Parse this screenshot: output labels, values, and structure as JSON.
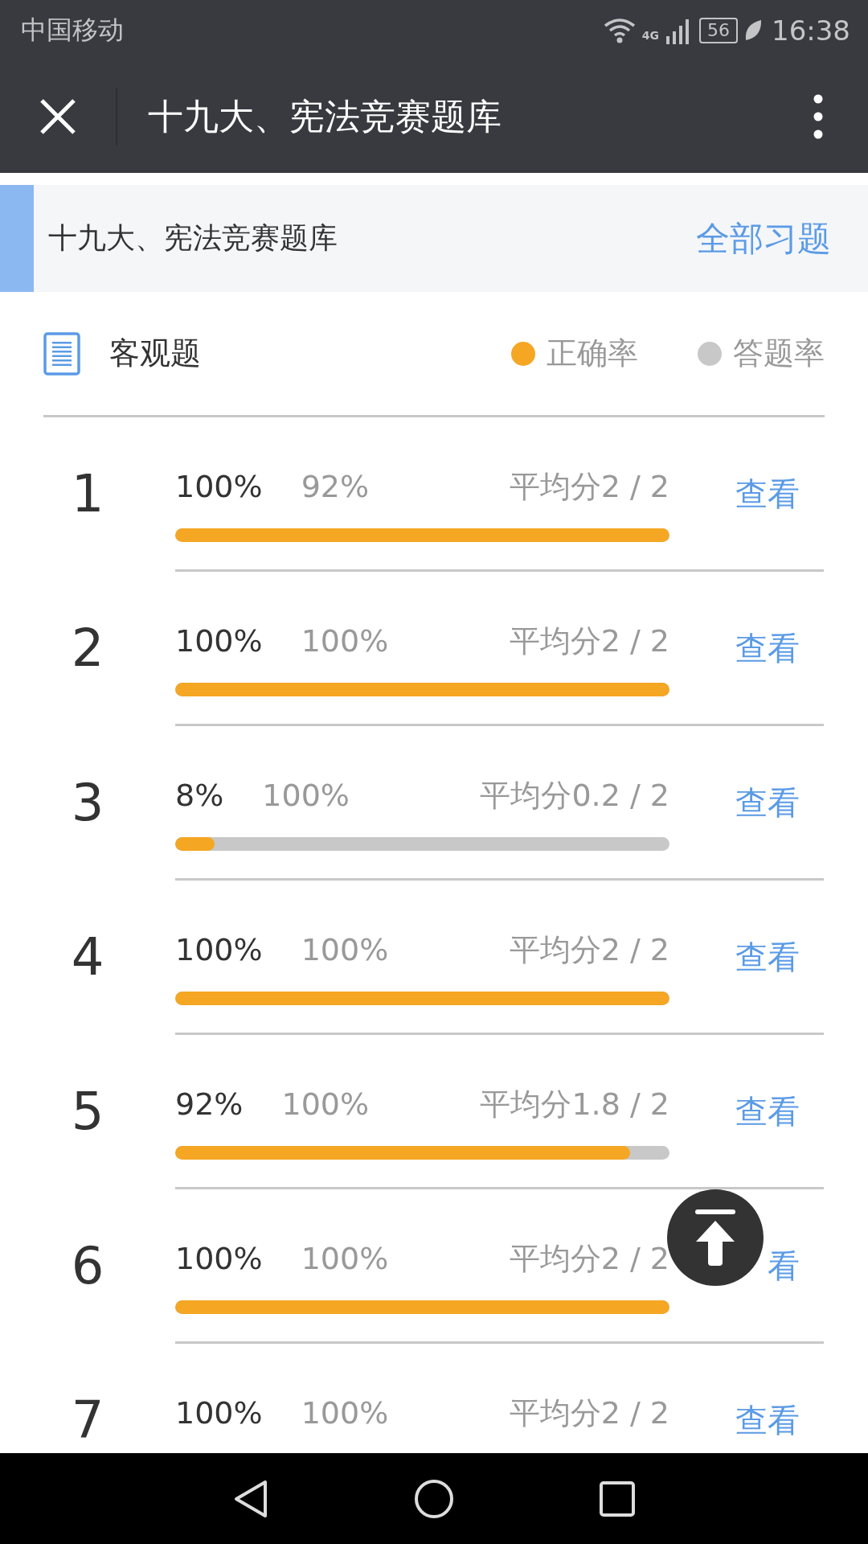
{
  "status_bar": {
    "carrier": "中国移动",
    "network": "4G",
    "battery": "56",
    "time": "16:38"
  },
  "toolbar": {
    "title": "十九大、宪法竞赛题库"
  },
  "header": {
    "title": "十九大、宪法竞赛题库",
    "link": "全部习题"
  },
  "section": {
    "title": "客观题",
    "legend": [
      {
        "label": "正确率",
        "color": "#f5a623"
      },
      {
        "label": "答题率",
        "color": "#c8c8c8"
      }
    ]
  },
  "rows": [
    {
      "number": "1",
      "correct": "100%",
      "answered": "92%",
      "score": "平均分2 / 2",
      "level": 1,
      "link": "查看"
    },
    {
      "number": "2",
      "correct": "100%",
      "answered": "100%",
      "score": "平均分2 / 2",
      "level": 1,
      "link": "查看"
    },
    {
      "number": "3",
      "correct": "8%",
      "answered": "100%",
      "score": "平均分0.2 / 2",
      "level": 0.08,
      "link": "查看"
    },
    {
      "number": "4",
      "correct": "100%",
      "answered": "100%",
      "score": "平均分2 / 2",
      "level": 1,
      "link": "查看"
    },
    {
      "number": "5",
      "correct": "92%",
      "answered": "100%",
      "score": "平均分1.8 / 2",
      "level": 0.92,
      "link": "查看"
    },
    {
      "number": "6",
      "correct": "100%",
      "answered": "100%",
      "score": "平均分2 / 2",
      "level": 1,
      "link": "看"
    },
    {
      "number": "7",
      "correct": "100%",
      "answered": "100%",
      "score": "平均分2 / 2",
      "link": "查看"
    }
  ]
}
